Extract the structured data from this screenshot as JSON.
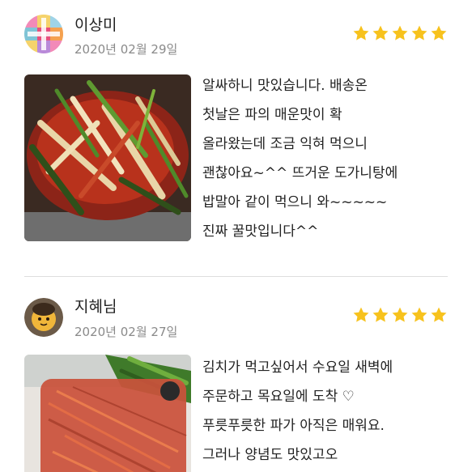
{
  "reviews": [
    {
      "username": "이상미",
      "date": "2020년 02월 29일",
      "rating": 5,
      "star_color": "#f7c21d",
      "avatar_icon": "colorful-pattern-avatar",
      "photo_icon": "green-onion-kimchi-photo",
      "text": "알싸하니 맛있습니다. 배송온\n첫날은 파의 매운맛이 확\n올라왔는데 조금 익혀 먹으니\n괜찮아요~^^  뜨거운 도가니탕에\n밥말아 같이 먹으니 와~~~~~\n진짜 꿀맛입니다^^"
    },
    {
      "username": "지혜님",
      "date": "2020년 02월 27일",
      "rating": 5,
      "star_color": "#f7c21d",
      "avatar_icon": "character-avatar",
      "photo_icon": "packaged-kimchi-photo",
      "text": "김치가 먹고싶어서 수요일 새벽에\n주문하고 목요일에 도착 ♡\n푸릇푸릇한 파가 아직은 매워요.\n그러나 양념도 맛있고오"
    }
  ]
}
